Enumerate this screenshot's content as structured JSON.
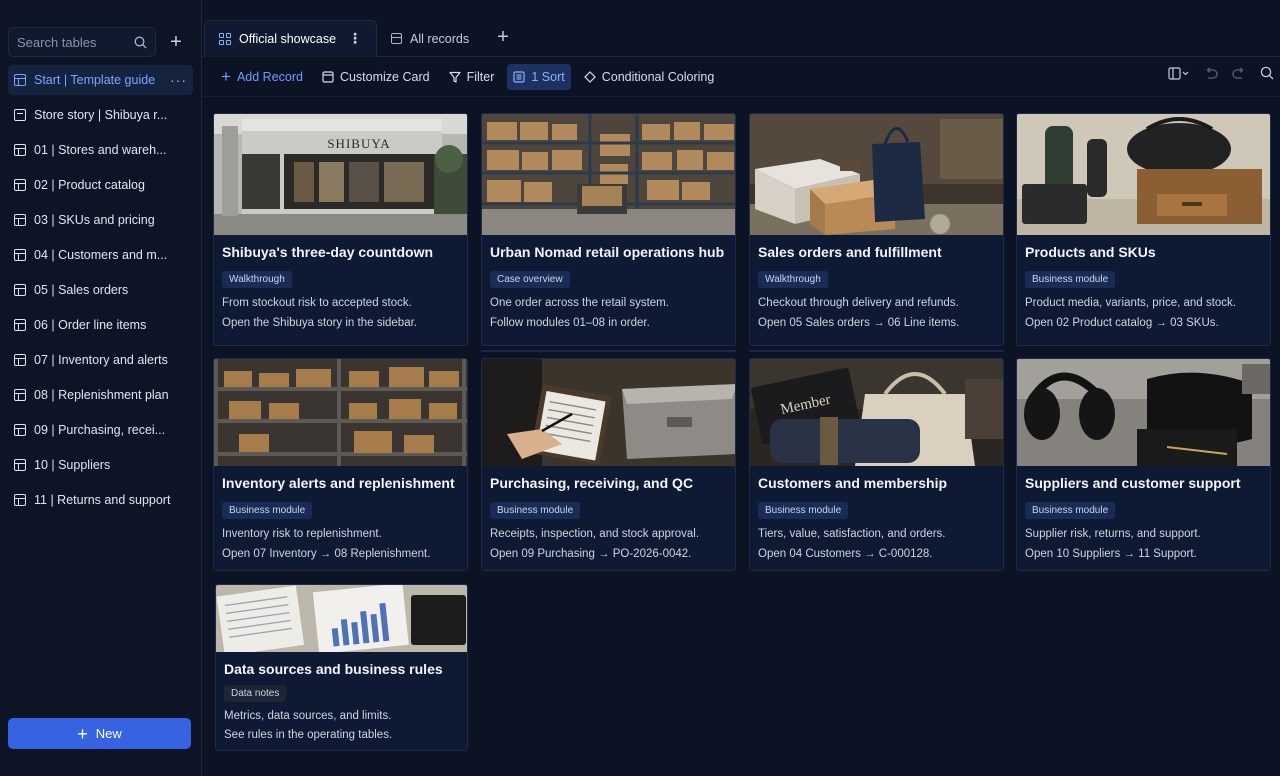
{
  "sidebar": {
    "search_placeholder": "Search tables",
    "items": [
      {
        "label": "Start | Template guide",
        "icon": "table-icon",
        "active": true
      },
      {
        "label": "Store story | Shibuya r...",
        "icon": "document-icon"
      },
      {
        "label": "01 | Stores and wareh...",
        "icon": "table-icon"
      },
      {
        "label": "02 | Product catalog",
        "icon": "table-icon"
      },
      {
        "label": "03 | SKUs and pricing",
        "icon": "table-icon"
      },
      {
        "label": "04 | Customers and m...",
        "icon": "table-icon"
      },
      {
        "label": "05 | Sales orders",
        "icon": "table-icon"
      },
      {
        "label": "06 | Order line items",
        "icon": "table-icon"
      },
      {
        "label": "07 | Inventory and alerts",
        "icon": "table-icon"
      },
      {
        "label": "08 | Replenishment plan",
        "icon": "table-icon"
      },
      {
        "label": "09 | Purchasing, recei...",
        "icon": "table-icon"
      },
      {
        "label": "10 | Suppliers",
        "icon": "table-icon"
      },
      {
        "label": "11 | Returns and support",
        "icon": "table-icon"
      }
    ],
    "more_glyph": "···",
    "new_label": "New"
  },
  "tabs": [
    {
      "label": "Official showcase",
      "icon": "gallery-icon",
      "active": true
    },
    {
      "label": "All records",
      "icon": "table-icon"
    }
  ],
  "toolbar": {
    "add_record": "Add Record",
    "customize_card": "Customize Card",
    "filter": "Filter",
    "sort": "1 Sort",
    "conditional_coloring": "Conditional Coloring"
  },
  "cards": [
    {
      "title": "Shibuya's three-day countdown",
      "tag": "Walkthrough",
      "line1": "From stockout risk to accepted stock.",
      "line2": "Open the Shibuya story in the sidebar.",
      "image": "storefront-photo",
      "image_label": "SHIBUYA"
    },
    {
      "title": "Urban Nomad retail operations hub",
      "tag": "Case overview",
      "line1": "One order across the retail system.",
      "line2": "Follow modules 01–08 in order.",
      "image": "warehouse-photo"
    },
    {
      "title": "Sales orders and fulfillment",
      "tag": "Walkthrough",
      "line1": "Checkout through delivery and refunds.",
      "line2": "Open 05 Sales orders → 06 Line items.",
      "image": "packages-photo"
    },
    {
      "title": "Products and SKUs",
      "tag": "Business module",
      "line1": "Product media, variants, price, and stock.",
      "line2": "Open 02 Product catalog → 03 SKUs.",
      "image": "products-photo"
    },
    {
      "title": "Inventory alerts and replenishment",
      "tag": "Business module",
      "line1": "Inventory risk to replenishment.",
      "line2": "Open 07 Inventory → 08 Replenishment.",
      "image": "shelves-photo"
    },
    {
      "title": "Purchasing, receiving, and QC",
      "tag": "Business module",
      "line1": "Receipts, inspection, and stock approval.",
      "line2": "Open 09 Purchasing → PO-2026-0042.",
      "image": "clipboard-photo"
    },
    {
      "title": "Customers and membership",
      "tag": "Business module",
      "line1": "Tiers, value, satisfaction, and orders.",
      "line2": "Open 04 Customers → C-000128.",
      "image": "member-card-photo",
      "image_label": "Member"
    },
    {
      "title": "Suppliers and customer support",
      "tag": "Business module",
      "line1": "Supplier risk, returns, and support.",
      "line2": "Open 10 Suppliers → 11 Support.",
      "image": "headphones-photo"
    },
    {
      "title": "Data sources and business rules",
      "tag": "Data notes",
      "line1": "Metrics, data sources, and limits.",
      "line2": "See rules in the operating tables.",
      "image": "documents-photo"
    }
  ],
  "colors": {
    "accent": "#3762e2",
    "background": "#0b1324",
    "card": "#0e1a33",
    "tag": "#1a2c55"
  }
}
